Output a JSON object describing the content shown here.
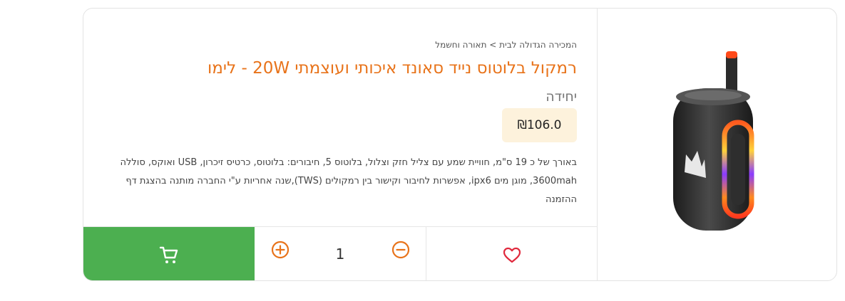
{
  "product": {
    "breadcrumb": "המכירה הגדולה לבית > תאורה וחשמל",
    "title": "רמקול בלוטוס נייד סאונד איכותי ועוצמתי 20W - לימו",
    "unit": "יחידה",
    "price": "₪106.0",
    "description": "באורך של כ 19 ס\"מ, חוויית שמע עם צליל חזק וצלול, בלוטוס 5, חיבורים: בלוטוס, כרטיס זיכרון, USB ואוקס, סוללה 3600mah, מוגן מים ipx6, אפשרות לחיבור וקישור בין רמקולים (TWS),שנה אחריות ע\"י החברה מותנה בהצגת דף ההזמנה",
    "quantity": "1"
  },
  "icons": {
    "cart": "shopping-cart-icon",
    "plus": "plus-circle-icon",
    "minus": "minus-circle-icon",
    "heart": "heart-outline-icon"
  },
  "colors": {
    "accent": "#e8731a",
    "cart_button": "#4caf50",
    "price_bg": "#fdf2dc",
    "heart": "#e0283c"
  }
}
